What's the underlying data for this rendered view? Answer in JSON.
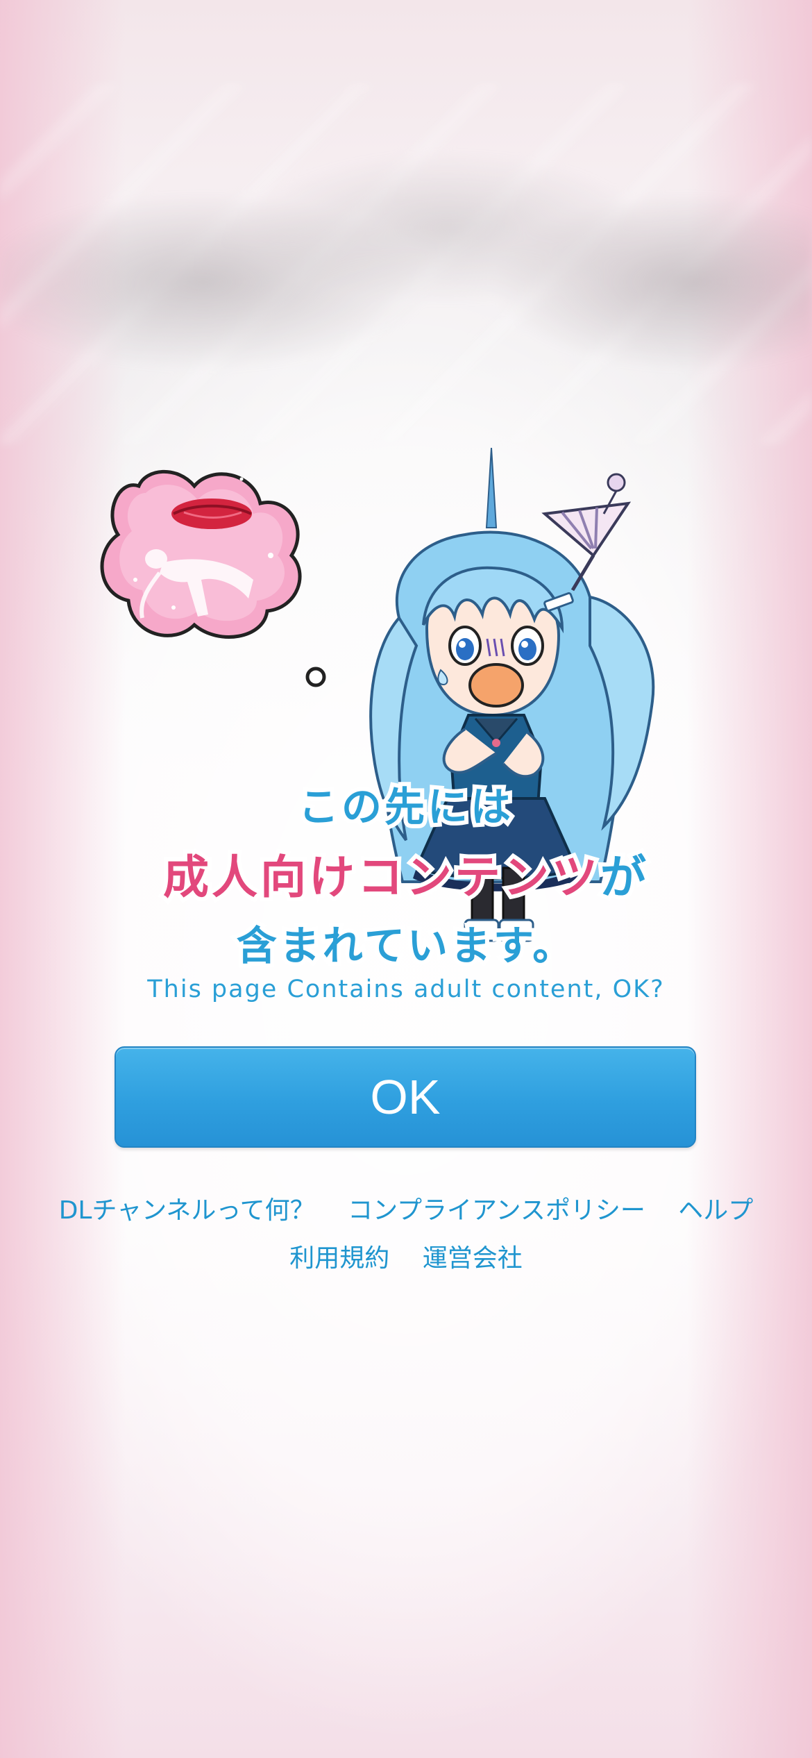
{
  "heading": {
    "line1": "この先には",
    "line2_pink": "成人向けコンテンツ",
    "line2_blue": "が",
    "line3": "含まれています。"
  },
  "subtitle": "This page Contains adult content, OK?",
  "ok_button": {
    "label": "OK"
  },
  "footer_links": {
    "row1": [
      "DLチャンネルって何？",
      "コンプライアンスポリシー",
      "ヘルプ"
    ],
    "row2": [
      "利用規約",
      "運営会社"
    ]
  },
  "colors": {
    "accent_blue": "#2a9fd6",
    "accent_pink": "#e2487c",
    "button_blue": "#2f9fdf"
  },
  "icons": {
    "thought_bubble": "thought-bubble-lips-icon",
    "mascot": "mascot-character-illustration"
  }
}
